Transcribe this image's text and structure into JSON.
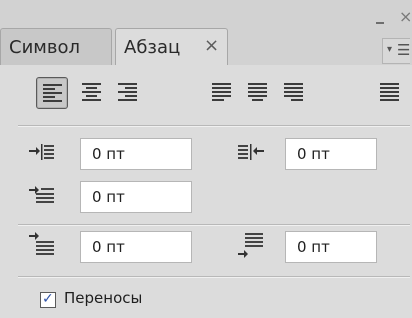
{
  "window": {
    "minimize": "–",
    "close": "×"
  },
  "tabs": {
    "symbol": {
      "label": "Символ"
    },
    "paragraph": {
      "label": "Абзац",
      "close": "×"
    }
  },
  "alignment": {
    "buttons": [
      "align-left",
      "align-center",
      "align-right",
      "justify-last-left",
      "justify-last-center",
      "justify-last-right",
      "justify-all"
    ],
    "selected": "align-left"
  },
  "indents": {
    "left": {
      "value": "0 пт"
    },
    "right": {
      "value": "0 пт"
    },
    "first_line": {
      "value": "0 пт"
    }
  },
  "spacing": {
    "before": {
      "value": "0 пт"
    },
    "after": {
      "value": "0 пт"
    }
  },
  "hyphenation": {
    "label": "Переносы",
    "checked": true
  }
}
